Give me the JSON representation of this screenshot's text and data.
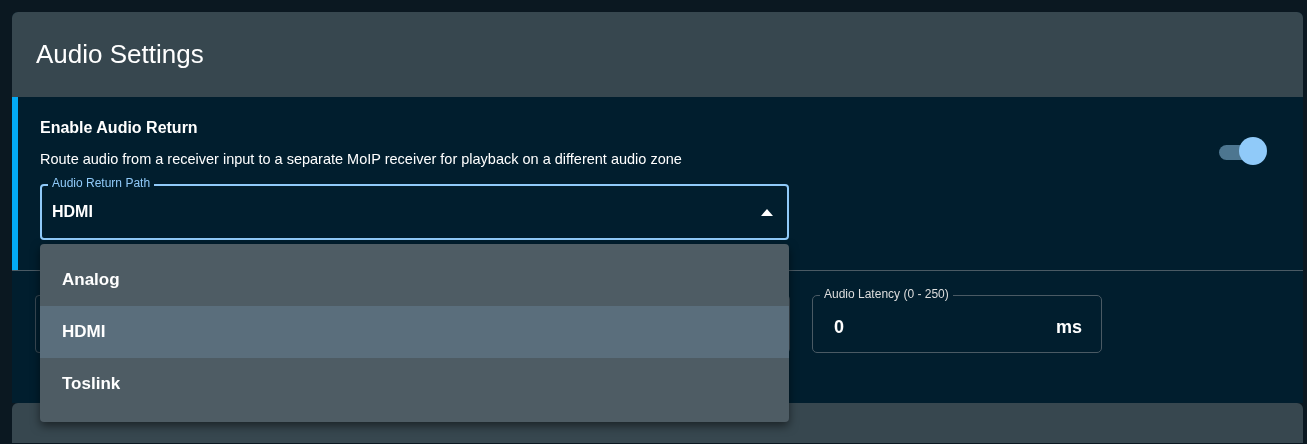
{
  "card": {
    "title": "Audio Settings"
  },
  "audio_return": {
    "title": "Enable Audio Return",
    "description": "Route audio from a receiver input to a separate MoIP receiver for playback on a different audio zone",
    "on": true
  },
  "return_path": {
    "label": "Audio Return Path",
    "value": "HDMI",
    "expanded": true,
    "options": [
      {
        "label": "Analog",
        "selected": false
      },
      {
        "label": "HDMI",
        "selected": true
      },
      {
        "label": "Toslink",
        "selected": false
      }
    ]
  },
  "latency": {
    "label": "Audio Latency (0 - 250)",
    "value": "0",
    "unit": "ms"
  }
}
